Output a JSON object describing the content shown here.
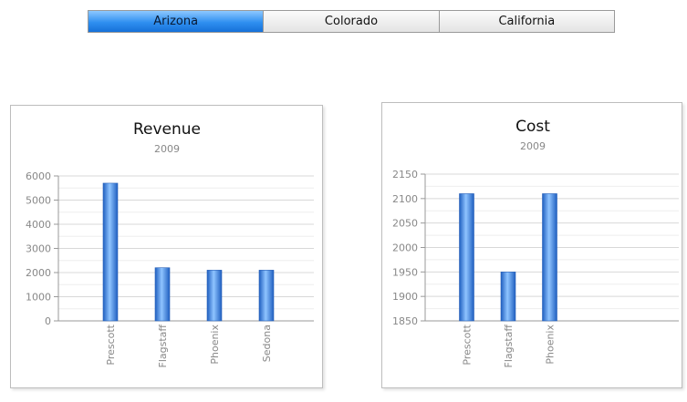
{
  "tabs": [
    {
      "label": "Arizona",
      "active": true
    },
    {
      "label": "Colorado",
      "active": false
    },
    {
      "label": "California",
      "active": false
    }
  ],
  "colors": {
    "bar_dark": "#1f5fc0",
    "bar_light": "#8fc4ff",
    "grid": "#d8d8d8",
    "axis": "#999999",
    "tab_active": "#2f8ff0"
  },
  "chart_data": [
    {
      "type": "bar",
      "title": "Revenue",
      "subtitle": "2009",
      "categories": [
        "Prescott",
        "Flagstaff",
        "Phoenix",
        "Sedona"
      ],
      "values": [
        5700,
        2200,
        2100,
        2100
      ],
      "ylim": [
        0,
        6000
      ],
      "yticks": [
        0,
        1000,
        2000,
        3000,
        4000,
        5000,
        6000
      ],
      "grid": true
    },
    {
      "type": "bar",
      "title": "Cost",
      "subtitle": "2009",
      "categories": [
        "Prescott",
        "Flagstaff",
        "Phoenix"
      ],
      "values": [
        2110,
        1950,
        2110
      ],
      "ylim": [
        1850,
        2150
      ],
      "yticks": [
        1850,
        1900,
        1950,
        2000,
        2050,
        2100,
        2150
      ],
      "grid": true
    }
  ]
}
